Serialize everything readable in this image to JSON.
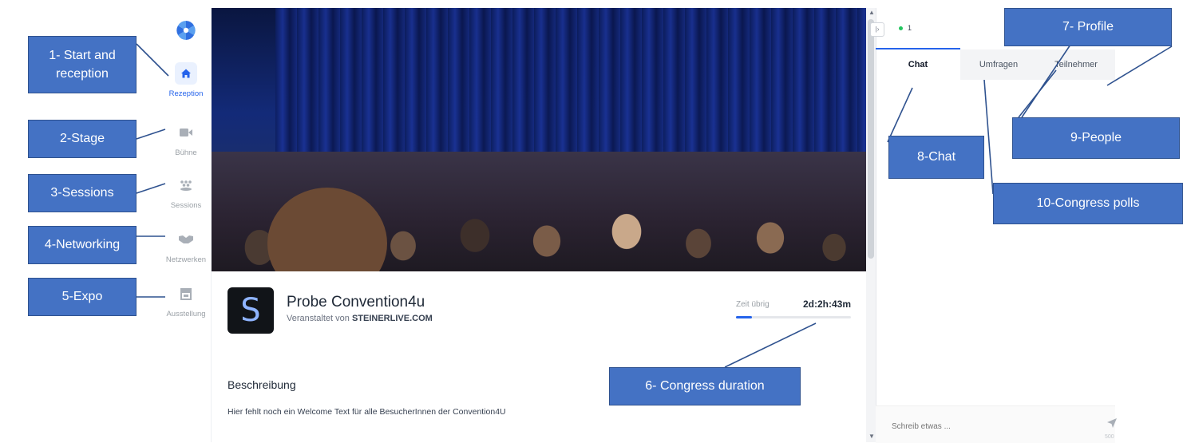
{
  "sidebar": {
    "logo_icon": "pinwheel-logo-icon",
    "items": [
      {
        "label": "Rezeption",
        "icon": "home-icon",
        "glyph": "⌂",
        "active": true
      },
      {
        "label": "Bühne",
        "icon": "video-camera-icon",
        "glyph": "▬"
      },
      {
        "label": "Sessions",
        "icon": "people-group-icon",
        "glyph": "⁂"
      },
      {
        "label": "Netzwerken",
        "icon": "handshake-icon",
        "glyph": "✋"
      },
      {
        "label": "Ausstellung",
        "icon": "storefront-icon",
        "glyph": "▤"
      }
    ]
  },
  "event": {
    "logo_letter": "S",
    "title": "Probe Convention4u",
    "organizer_prefix": "Veranstaltet von ",
    "organizer_name": "STEINERLIVE.COM",
    "time_left_label": "Zeit übrig",
    "time_left_value": "2d:2h:43m",
    "time_progress": 0.14,
    "description_title": "Beschreibung",
    "description_text": "Hier fehlt noch ein Welcome Text für alle BesucherInnen der Convention4U"
  },
  "right_panel": {
    "collapse_icon": "collapse-panel-icon",
    "online_count": "1",
    "tabs": [
      "Chat",
      "Umfragen",
      "Teilnehmer"
    ],
    "chat_placeholder": "Schreib etwas ...",
    "send_icon": "send-icon",
    "char_counter": "500"
  },
  "callouts": {
    "c1": "1- Start and reception",
    "c2": "2-Stage",
    "c3": "3-Sessions",
    "c4": "4-Networking",
    "c5": "5-Expo",
    "c6": "6- Congress duration",
    "c7": "7- Profile",
    "c8": "8-Chat",
    "c9": "9-People",
    "c10": "10-Congress polls"
  },
  "colors": {
    "accent": "#2563eb",
    "callout_fill": "#4472c4",
    "callout_border": "#2f528f",
    "online": "#22c55e"
  }
}
